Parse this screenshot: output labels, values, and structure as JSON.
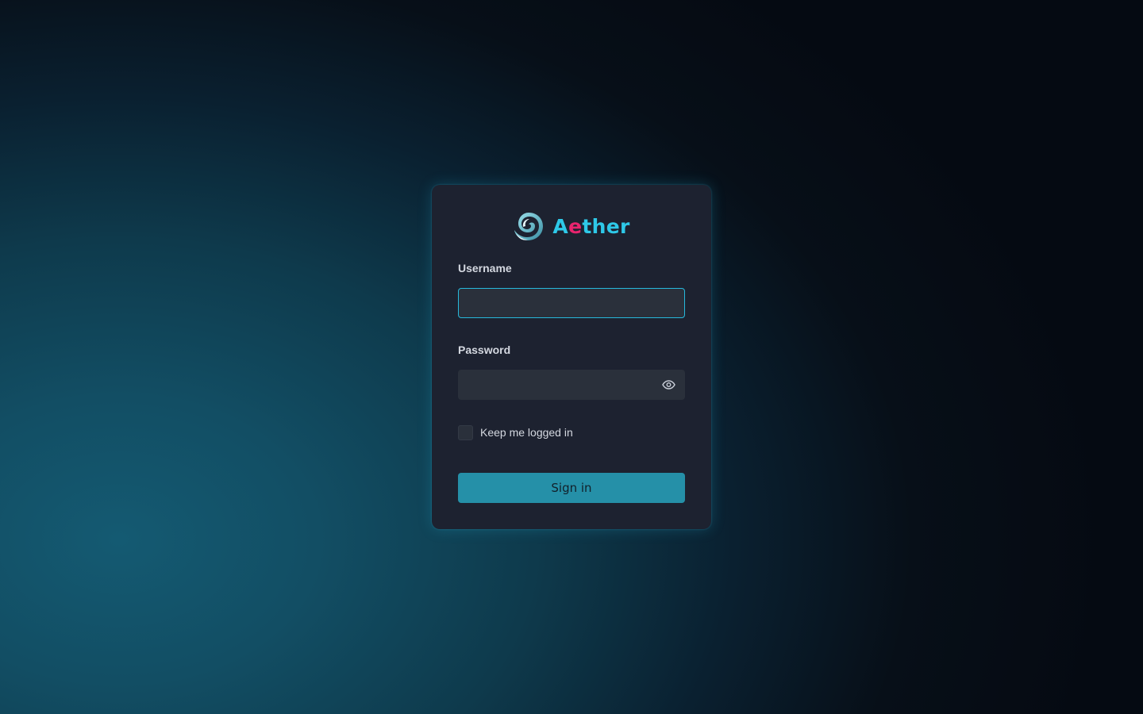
{
  "brand": {
    "name_part1": "A",
    "name_accent": "e",
    "name_part2": "ther",
    "logo_icon": "swirl-logo-icon",
    "colors": {
      "primary": "#2ec9e8",
      "accent": "#e8246e"
    }
  },
  "form": {
    "username": {
      "label": "Username",
      "value": "",
      "placeholder": ""
    },
    "password": {
      "label": "Password",
      "value": "",
      "placeholder": "",
      "toggle_icon": "eye-icon"
    },
    "remember": {
      "label": "Keep me logged in",
      "checked": false
    },
    "submit_label": "Sign in"
  },
  "colors": {
    "button": "#2590a8",
    "focus_border": "#27b9dc",
    "card": "#1d2230",
    "input": "#2a303b"
  }
}
